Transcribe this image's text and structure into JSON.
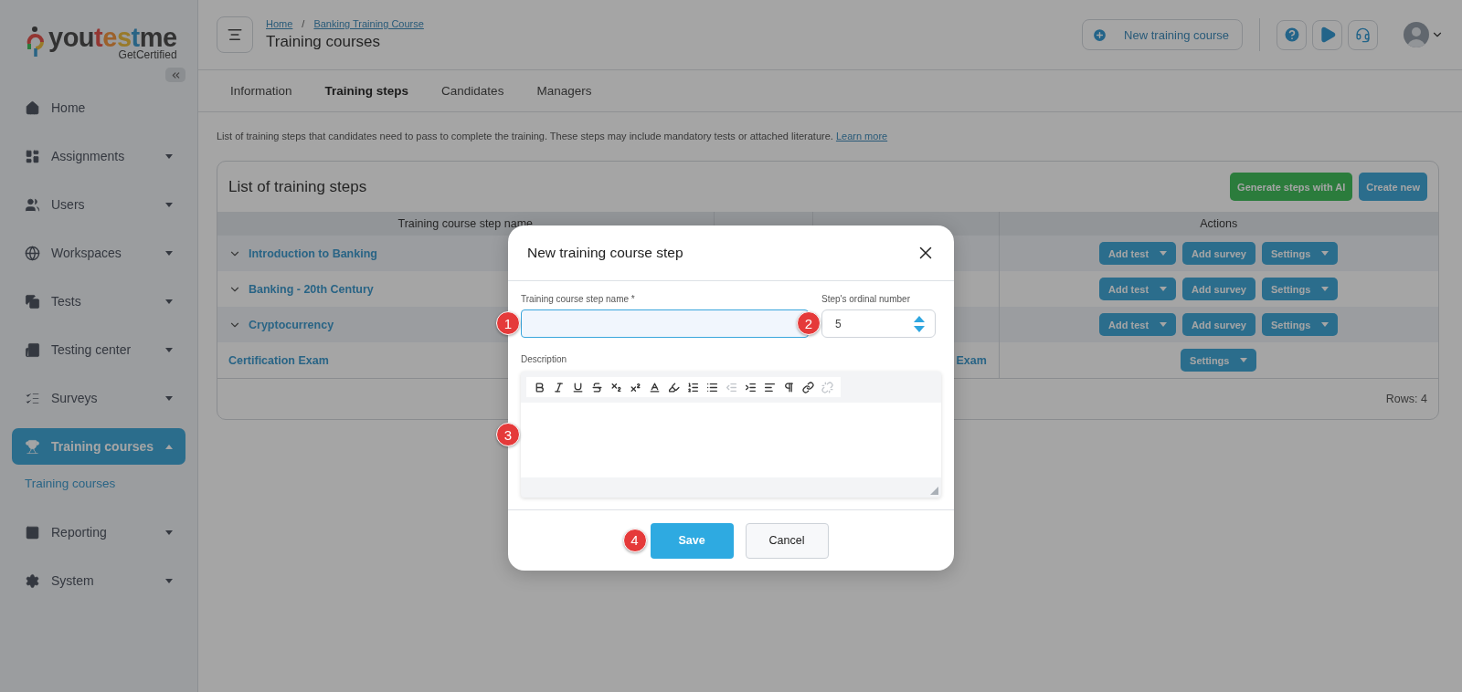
{
  "sidebar": {
    "logo": {
      "word": "youtestme",
      "tagline": "GetCertified"
    },
    "items": [
      {
        "kind": "home",
        "label": "Home",
        "selected": false
      },
      {
        "kind": "assignments",
        "label": "Assignments",
        "selected": false,
        "expanded": false
      },
      {
        "kind": "users",
        "label": "Users",
        "selected": false,
        "expanded": false
      },
      {
        "kind": "workspaces",
        "label": "Workspaces",
        "selected": false,
        "expanded": false
      },
      {
        "kind": "tests",
        "label": "Tests",
        "selected": false,
        "expanded": false
      },
      {
        "kind": "center",
        "label": "Testing center",
        "selected": false,
        "expanded": false
      },
      {
        "kind": "surveys",
        "label": "Surveys",
        "selected": false,
        "expanded": false
      },
      {
        "kind": "training",
        "label": "Training courses",
        "selected": true,
        "expanded": true,
        "children": [
          {
            "label": "Training courses",
            "selected": true
          }
        ]
      },
      {
        "kind": "reporting",
        "label": "Reporting",
        "selected": false,
        "expanded": false
      },
      {
        "kind": "system",
        "label": "System",
        "selected": false,
        "expanded": false
      }
    ]
  },
  "header": {
    "breadcrumbs": [
      "Home",
      "Banking Training Course"
    ],
    "separator": "/",
    "title": "Training courses",
    "new_button": "New training course"
  },
  "tabs": [
    {
      "label": "Information",
      "selected": false
    },
    {
      "label": "Training steps",
      "selected": true
    },
    {
      "label": "Candidates",
      "selected": false
    },
    {
      "label": "Managers",
      "selected": false
    }
  ],
  "intro": {
    "text": "List of training steps that candidates need to pass to complete the training. These steps may include mandatory tests or attached literature.",
    "link": "Learn more"
  },
  "card": {
    "title": "List of training steps",
    "buttons": [
      {
        "kind": "ai",
        "label": "Generate steps with AI"
      },
      {
        "kind": "primary",
        "label": "Create new"
      }
    ],
    "columns": [
      "Training course step name",
      "Actions"
    ],
    "rows": [
      {
        "name": "Introduction to Banking",
        "expanded": false,
        "actions": [
          {
            "label": "Add test",
            "dropdown": true
          },
          {
            "label": "Add survey",
            "dropdown": false
          },
          {
            "label": "Settings",
            "dropdown": true
          }
        ]
      },
      {
        "name": "Banking - 20th Century",
        "expanded": false,
        "actions": [
          {
            "label": "Add test",
            "dropdown": true
          },
          {
            "label": "Add survey",
            "dropdown": false
          },
          {
            "label": "Settings",
            "dropdown": true
          }
        ]
      },
      {
        "name": "Cryptocurrency",
        "expanded": false,
        "actions": [
          {
            "label": "Add test",
            "dropdown": true
          },
          {
            "label": "Add survey",
            "dropdown": false
          },
          {
            "label": "Settings",
            "dropdown": true
          }
        ]
      },
      {
        "name": "Certification Exam",
        "assignment": "Exam",
        "actions": [
          {
            "label": "Settings",
            "dropdown": true
          }
        ]
      }
    ],
    "footer": "Rows: 4"
  },
  "dialog": {
    "title": "New training course step",
    "name_field": {
      "label": "Training course step name",
      "required_mark": "*",
      "focused": true,
      "marker": "1"
    },
    "ordinal_field": {
      "label": "Step's ordinal number",
      "value": "5",
      "marker": "2"
    },
    "description": {
      "label": "Description",
      "marker": "3",
      "toolbar": [
        {
          "kind": "bold",
          "disabled": false
        },
        {
          "kind": "italic",
          "disabled": false
        },
        {
          "kind": "underline",
          "disabled": false
        },
        {
          "kind": "strike",
          "disabled": false
        },
        {
          "kind": "subscript",
          "disabled": false
        },
        {
          "kind": "superscript",
          "disabled": false
        },
        {
          "kind": "color",
          "disabled": false
        },
        {
          "kind": "background",
          "disabled": false
        },
        {
          "kind": "ordered",
          "disabled": false
        },
        {
          "kind": "bullets",
          "disabled": false
        },
        {
          "kind": "outdent",
          "disabled": true
        },
        {
          "kind": "indent",
          "disabled": false
        },
        {
          "kind": "align",
          "disabled": false
        },
        {
          "kind": "direction",
          "disabled": false
        },
        {
          "kind": "link",
          "disabled": false
        },
        {
          "kind": "unlink",
          "disabled": true
        }
      ]
    },
    "buttons": [
      {
        "kind": "primary",
        "label": "Save",
        "marker": "4"
      },
      {
        "kind": "secondary",
        "label": "Cancel"
      }
    ]
  }
}
